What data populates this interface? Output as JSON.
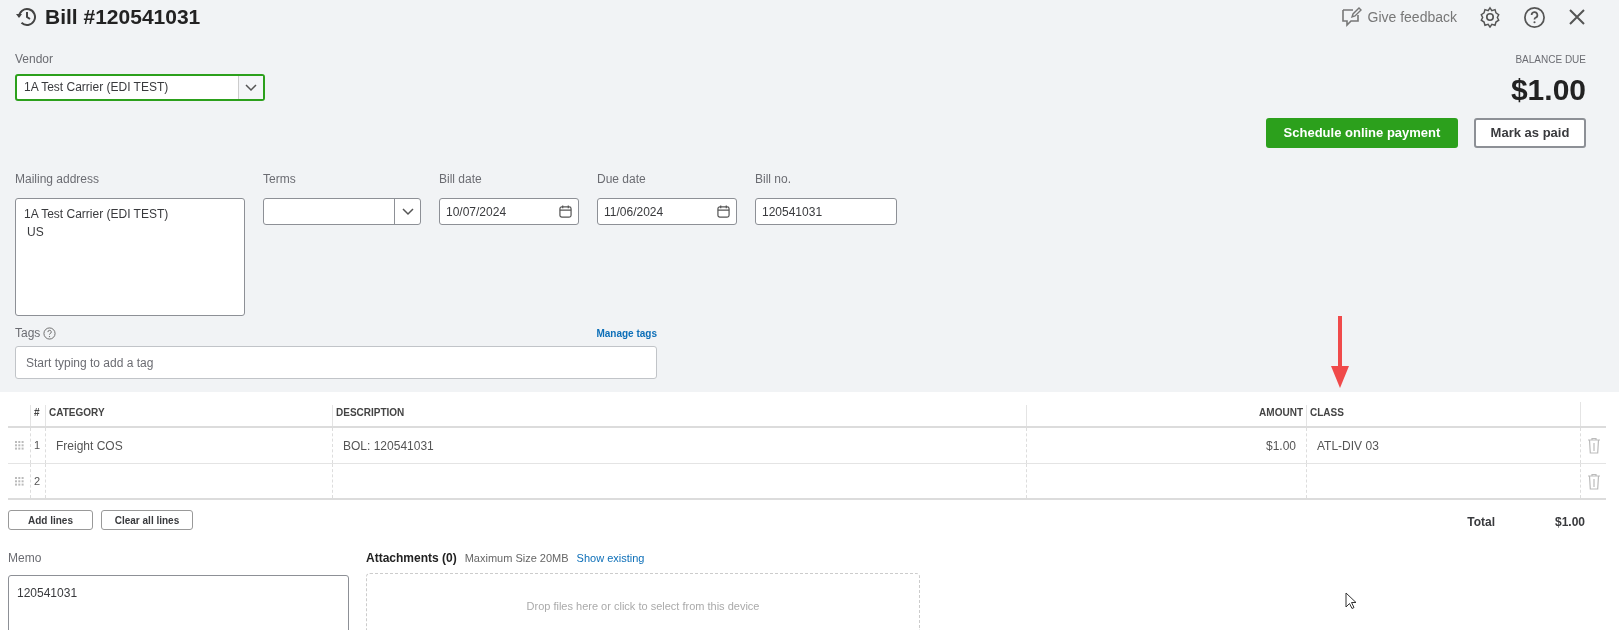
{
  "header": {
    "title": "Bill #120541031",
    "feedback": "Give feedback"
  },
  "vendor": {
    "label": "Vendor",
    "value": "1A Test Carrier (EDI TEST)",
    "focused": true
  },
  "balance": {
    "label": "BALANCE DUE",
    "amount": "$1.00"
  },
  "actions": [
    "Schedule online payment",
    "Mark as paid"
  ],
  "fields": [
    {
      "kind": "address",
      "label": "Mailing address",
      "lines": [
        "1A Test Carrier (EDI TEST)",
        "US"
      ]
    },
    {
      "kind": "select",
      "label": "Terms"
    },
    {
      "kind": "date",
      "label": "Bill date",
      "value": "10/07/2024"
    },
    {
      "kind": "date",
      "label": "Due date",
      "value": "11/06/2024"
    },
    {
      "kind": "text",
      "label": "Bill no.",
      "value": "120541031"
    }
  ],
  "tags": {
    "label": "Tags",
    "link": "Manage tags",
    "placeholder": "Start typing to add a tag"
  },
  "table": {
    "columns": [
      "#",
      "CATEGORY",
      "DESCRIPTION",
      "AMOUNT",
      "CLASS"
    ],
    "rows": [
      {
        "num": "1",
        "category": "Freight COS",
        "description": "BOL: 120541031",
        "amount": "$1.00",
        "class": "ATL-DIV 03"
      },
      {
        "num": "2"
      }
    ]
  },
  "line_buttons": [
    "Add lines",
    "Clear all lines"
  ],
  "total": {
    "label": "Total",
    "amount": "$1.00"
  },
  "memo": {
    "label": "Memo",
    "value": "120541031"
  },
  "attachments": {
    "title": "Attachments (0)",
    "note": "Maximum Size 20MB",
    "link": "Show existing",
    "drop_text": "Drop files here or click to select from this device"
  }
}
